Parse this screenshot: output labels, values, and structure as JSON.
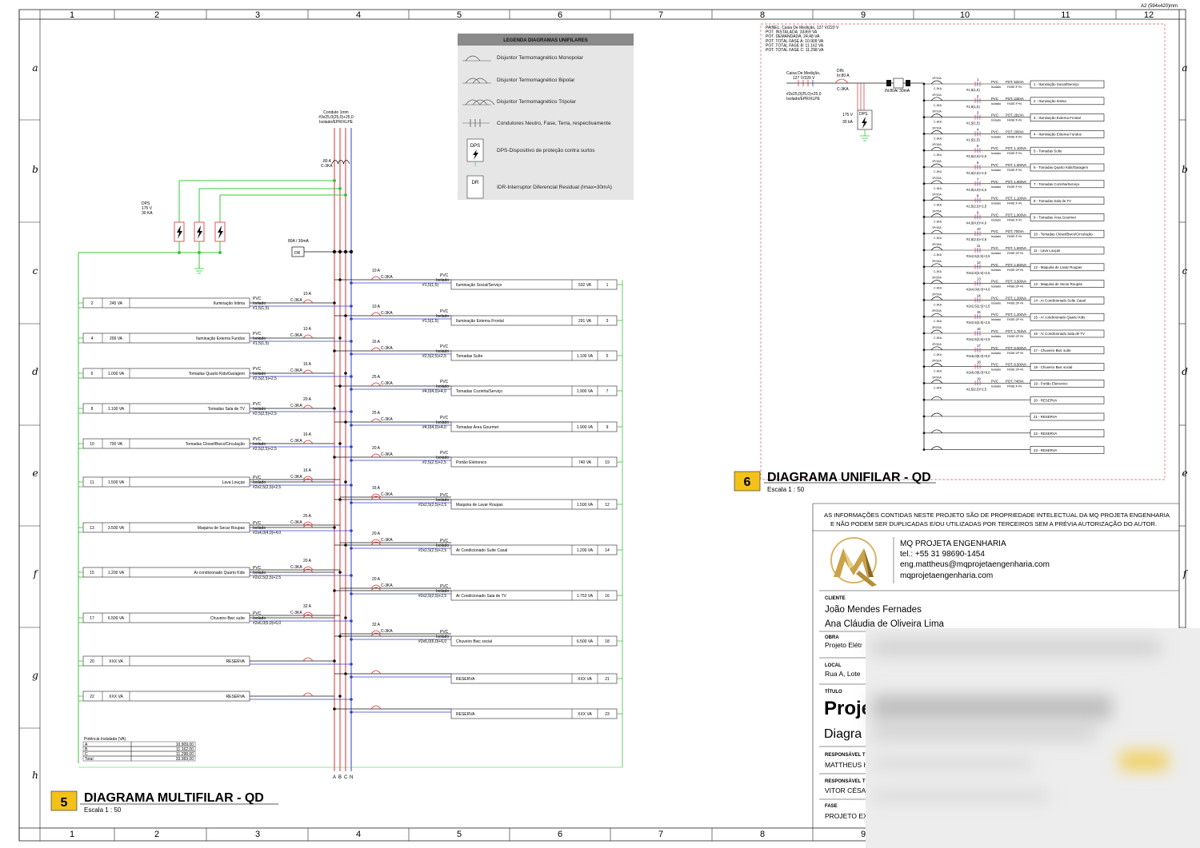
{
  "sheet": {
    "format": "A2 (594x420)mm",
    "col_labels": [
      "1",
      "2",
      "3",
      "4",
      "5",
      "6",
      "7",
      "8",
      "9",
      "10",
      "11",
      "12"
    ],
    "row_labels": [
      "a",
      "b",
      "c",
      "d",
      "e",
      "f",
      "g",
      "h"
    ]
  },
  "legend": {
    "title": "LEGENDA DIAGRAMAS UNIFILARES",
    "items": [
      {
        "icon": "monopolar-breaker-icon",
        "label": "Disjuntor Termomagnético Monopolar"
      },
      {
        "icon": "bipolar-breaker-icon",
        "label": "Disjuntor Termomagnético Bipolar"
      },
      {
        "icon": "tripolar-breaker-icon",
        "label": "Disjuntor Termomagnético Tripolar"
      },
      {
        "icon": "conductors-icon",
        "label": "Condutores Neutro, Fase, Terra, respectivamente"
      },
      {
        "icon": "dps-icon",
        "badge": "DPS",
        "label": "DPS-Dispositivo de proteção contra surtos"
      },
      {
        "icon": "idr-icon",
        "badge": "DR",
        "label": "IDR-Interruptor Diferencial Residual (Imax=30mA)"
      }
    ]
  },
  "multifilar": {
    "number": "5",
    "title": "DIAGRAMA MULTIFILAR - QD",
    "scale": "Escala   1 : 50",
    "conduit": [
      "Conduto 1mm",
      "#3x25,0(25,0)+25,0",
      "Isolado/EPR/XLPE"
    ],
    "main_breaker": [
      "80 A",
      "C-3KA"
    ],
    "dps": [
      "DPS",
      "175 V",
      "30 KA"
    ],
    "dr": {
      "rating": "80A / 30mA",
      "badge": "DR"
    },
    "phase_labels": [
      "A",
      "B",
      "C",
      "N"
    ],
    "left_circuits": [
      {
        "num": "2",
        "pot": "245 VA",
        "desc": "Iluminação Intima",
        "breaker": "10 A",
        "curve": "C-3KA",
        "cable": "#1,5(1,5)"
      },
      {
        "num": "4",
        "pot": "209 VA",
        "desc": "Iluminação Externa Fundos",
        "breaker": "10 A",
        "curve": "C-3KA",
        "cable": "#1,5(1,5)"
      },
      {
        "num": "6",
        "pot": "1.000 VA",
        "desc": "Tomadas Quarto Kids/Garagem",
        "breaker": "16 A",
        "curve": "C-3KA",
        "cable": "#2,5(2,5)+2,5"
      },
      {
        "num": "8",
        "pot": "1.100 VA",
        "desc": "Tomadas Sala de TV",
        "breaker": "20 A",
        "curve": "C-3KA",
        "cable": "#2,5(2,5)+2,5"
      },
      {
        "num": "10",
        "pot": "700 VA",
        "desc": "Tomadas Closet/Bwcs/Circulação",
        "breaker": "16 A",
        "curve": "C-3KA",
        "cable": "#2,5(2,5)+2,5"
      },
      {
        "num": "11",
        "pot": "1.500 VA",
        "desc": "Lava Louças",
        "breaker": "16 A",
        "curve": "C-3KA",
        "cable": "#2x2,5(2,5)+2,5"
      },
      {
        "num": "13",
        "pot": "3.500 VA",
        "desc": "Maquina de Secar Roupas",
        "breaker": "25 A",
        "curve": "C-3KA",
        "cable": "#2x4,0(4,0)+4,0"
      },
      {
        "num": "15",
        "pot": "1.200 VA",
        "desc": "Ar condicionado Quarto Kids",
        "breaker": "20 A",
        "curve": "C-3KA",
        "cable": "#2x2,5(2,5)+2,5"
      },
      {
        "num": "17",
        "pot": "6.500 VA",
        "desc": "Chuveiro Bwc suíte",
        "breaker": "32 A",
        "curve": "C-3KA",
        "cable": "#2x6,0(6,0)+6,0"
      },
      {
        "num": "20",
        "pot": "XXX VA",
        "desc": "RESERVA",
        "breaker": "",
        "curve": "",
        "cable": ""
      },
      {
        "num": "22",
        "pot": "XXX VA",
        "desc": "RESERVA",
        "breaker": "",
        "curve": "",
        "cable": ""
      }
    ],
    "right_circuits": [
      {
        "num": "1",
        "pot": "532 VA",
        "desc": "Iluminação Social/Serviço",
        "breaker": "10 A",
        "curve": "C-3KA",
        "cable": "#1,5(1,5)"
      },
      {
        "num": "3",
        "pot": "291 VA",
        "desc": "Iluminação Externa Frontal",
        "breaker": "10 A",
        "curve": "C-3KA",
        "cable": "#1,5(1,5)"
      },
      {
        "num": "5",
        "pot": "1.100 VA",
        "desc": "Tomadas Suíte",
        "breaker": "16 A",
        "curve": "C-3KA",
        "cable": "#2,5(2,5)+2,5"
      },
      {
        "num": "7",
        "pot": "1.900 VA",
        "desc": "Tomadas Cozinha/Serviço",
        "breaker": "25 A",
        "curve": "C-3KA",
        "cable": "#4,0(4,0)+4,0"
      },
      {
        "num": "9",
        "pot": "1.900 VA",
        "desc": "Tomadas Área Gourmet",
        "breaker": "25 A",
        "curve": "C-3KA",
        "cable": "#4,0(4,0)+4,0"
      },
      {
        "num": "19",
        "pot": "740 VA",
        "desc": "Portão Eletronico",
        "breaker": "20 A",
        "curve": "C-3KA",
        "cable": "#2,5(2,5)+2,5"
      },
      {
        "num": "12",
        "pot": "1.500 VA",
        "desc": "Maquina de Lavar Roupas",
        "breaker": "16 A",
        "curve": "C-3KA",
        "cable": "#2x2,5(2,5)+2,5"
      },
      {
        "num": "14",
        "pot": "1.200 VA",
        "desc": "Ar Condicionado Suíte Casal",
        "breaker": "20 A",
        "curve": "C-3KA",
        "cable": "#2x2,5(2,5)+2,5"
      },
      {
        "num": "16",
        "pot": "1.753 VA",
        "desc": "Ar Condicionado Sala de TV",
        "breaker": "20 A",
        "curve": "C-3KA",
        "cable": "#2x2,5(2,5)+2,5"
      },
      {
        "num": "18",
        "pot": "6.500 VA",
        "desc": "Chuveiro Bwc social",
        "breaker": "32 A",
        "curve": "C-3KA",
        "cable": "#2x6,0(6,0)+6,0"
      },
      {
        "num": "21",
        "pot": "XXX VA",
        "desc": "RESERVA",
        "breaker": "",
        "curve": "",
        "cable": ""
      },
      {
        "num": "23",
        "pot": "XXX VA",
        "desc": "RESERVA",
        "breaker": "",
        "curve": "",
        "cable": ""
      }
    ],
    "wire_texts": [
      "PVC",
      "Isolado"
    ],
    "power_table": {
      "title": "Potência Instalada (VA)",
      "rows": [
        {
          "phase": "A",
          "value": "10.909,00"
        },
        {
          "phase": "B",
          "value": "11.162,00"
        },
        {
          "phase": "C",
          "value": "11.298,00"
        },
        {
          "phase": "Total",
          "value": "33.369,00"
        }
      ]
    }
  },
  "unifilar": {
    "number": "6",
    "title": "DIAGRAMA UNIFILAR - QD",
    "scale": "Escala   1 : 50",
    "panel_info": [
      "PAINEL: Caixa De Medição, 127 V/220 V",
      "POT. INSTALADA: 33369 VA",
      "POT. DEMANDADA: 24,48 VA",
      "POT. TOTAL FASE A: 10.909 VA",
      "POT. TOTAL FASE B: 11.162 VA",
      "POT. TOTAL FASE C: 11.298 VA"
    ],
    "supply": [
      "Caixa De Medição,",
      "127 V/220 V"
    ],
    "supply_cable": [
      "#3x25,0(25,0)+25,0",
      "Isolado/EPR/XLPE"
    ],
    "din": [
      "DIN",
      "In:80 A"
    ],
    "din_curve": "C-3KA",
    "idr": "IN:80A/ 30mA",
    "dps": [
      "175 V",
      "30 kA"
    ],
    "dps_badge": "DPS",
    "circuits": [
      {
        "n": "1",
        "rating": "1P/10A",
        "cable": "#1,5(1,5)",
        "pot": "POT.:532VA",
        "fase": "FASE:F+N",
        "desc": "1 - Iluminação Social/Serviço"
      },
      {
        "n": "2",
        "rating": "1P/10A",
        "cable": "#1,5(1,5)",
        "pot": "POT.:245VA",
        "fase": "FASE:F+N",
        "desc": "2 - Iluminação Intima"
      },
      {
        "n": "3",
        "rating": "1P/10A",
        "cable": "#1,5(1,5)",
        "pot": "POT.:291VA",
        "fase": "FASE:F+N",
        "desc": "3 - Iluminação Externa Frontal"
      },
      {
        "n": "4",
        "rating": "1P/10A",
        "cable": "#1,5(1,5)",
        "pot": "POT.:209VA",
        "fase": "FASE:F+N",
        "desc": "4 - Iluminação Externa Fundos"
      },
      {
        "n": "5",
        "rating": "1P/16A",
        "cable": "#2,5(2,5)+2,5",
        "pot": "POT.:1.100VA",
        "fase": "FASE:F+N",
        "desc": "5 - Tomadas Suíte"
      },
      {
        "n": "6",
        "rating": "1P/16A",
        "cable": "#2,5(2,5)+2,5",
        "pot": "POT.:1.000VA",
        "fase": "FASE:F+N",
        "desc": "6 - Tomadas Quarto Kids/Garagem"
      },
      {
        "n": "7",
        "rating": "1P/25A",
        "cable": "#4,0(4,0)+4,0",
        "pot": "POT.:1.900VA",
        "fase": "FASE:F+N",
        "desc": "7 - Tomadas Cozinha/Serviço"
      },
      {
        "n": "8",
        "rating": "1P/20A",
        "cable": "#2,5(2,5)+2,5",
        "pot": "POT.:1.100VA",
        "fase": "FASE:F+N",
        "desc": "8 - Tomadas Sala de TV"
      },
      {
        "n": "9",
        "rating": "1P/25A",
        "cable": "#4,0(4,0)+4,0",
        "pot": "POT.:1.900VA",
        "fase": "FASE:F+N",
        "desc": "9 - Tomadas Área Gourmet"
      },
      {
        "n": "10",
        "rating": "1P/16A",
        "cable": "#2,5(2,5)+2,5",
        "pot": "POT.:700VA",
        "fase": "FASE:F+N",
        "desc": "10 - Tomadas Closet/Bwcs/Circulação"
      },
      {
        "n": "11",
        "rating": "2P/16A",
        "cable": "#2x2,5(2,5)+2,5",
        "pot": "POT.:1.500VA",
        "fase": "FASE:2F+N",
        "desc": "11 - Lava Louças"
      },
      {
        "n": "12",
        "rating": "2P/16A",
        "cable": "#2x2,5(2,5)+2,5",
        "pot": "POT.:1.500VA",
        "fase": "FASE:2F+N",
        "desc": "12 - Maquina de Lavar Roupas"
      },
      {
        "n": "13",
        "rating": "2P/25A",
        "cable": "#2x4,0(4,0)+4,0",
        "pot": "POT.:3.500VA",
        "fase": "FASE:2F+N",
        "desc": "13 - Maquina de Secar Roupas"
      },
      {
        "n": "14",
        "rating": "2P/20A",
        "cable": "#2x2,5(2,5)+2,5",
        "pot": "POT.:1.200VA",
        "fase": "FASE:2F+N",
        "desc": "14 - Ar Condicionado Suíte Casal"
      },
      {
        "n": "15",
        "rating": "2P/20A",
        "cable": "#2x2,5(2,5)+2,5",
        "pot": "POT.:1.200VA",
        "fase": "FASE:2F+N",
        "desc": "15 - Ar condicionado Quarto Kids"
      },
      {
        "n": "16",
        "rating": "2P/20A",
        "cable": "#2x2,5(2,5)+2,5",
        "pot": "POT.:1.753VA",
        "fase": "FASE:2F+N",
        "desc": "16 - Ar Condicionado Sala de TV"
      },
      {
        "n": "17",
        "rating": "2P/32A",
        "cable": "#2x6,0(6,0)+6,0",
        "pot": "POT.:6.500VA",
        "fase": "FASE:2F+N",
        "desc": "17 - Chuveiro Bwc suíte"
      },
      {
        "n": "18",
        "rating": "2P/32A",
        "cable": "#2x6,0(6,0)+6,0",
        "pot": "POT.:6.500VA",
        "fase": "FASE:2F+N",
        "desc": "18 - Chuveiro Bwc social"
      },
      {
        "n": "19",
        "rating": "1P/20A",
        "cable": "#2,5(2,5)+2,5",
        "pot": "POT.:740VA",
        "fase": "FASE:F+N",
        "desc": "19 - Portão Eletronico"
      },
      {
        "n": "",
        "rating": "",
        "cable": "",
        "pot": "",
        "fase": "",
        "desc": "20 - RESERVA"
      },
      {
        "n": "",
        "rating": "",
        "cable": "",
        "pot": "",
        "fase": "",
        "desc": "21 - RESERVA"
      },
      {
        "n": "",
        "rating": "",
        "cable": "",
        "pot": "",
        "fase": "",
        "desc": "22 - RESERVA"
      },
      {
        "n": "",
        "rating": "",
        "cable": "",
        "pot": "",
        "fase": "",
        "desc": "23 - RESERVA"
      }
    ],
    "wire_texts": [
      "PVC",
      "Isolado"
    ]
  },
  "title_block": {
    "disclaimer": [
      "AS INFORMAÇÕES CONTIDAS NESTE PROJETO SÃO DE PROPRIEDADE INTELECTUAL DA MQ PROJETA ENGENHARIA",
      "E NÃO PODEM SER DUPLICADAS E/OU UTILIZADAS POR TERCEIROS SEM A PRÉVIA AUTORIZAÇÃO DO AUTOR."
    ],
    "company": {
      "name": "MQ PROJETA ENGENHARIA",
      "phone": "tel.: +55 31 98690-1454",
      "email": "eng.mattheus@mqprojetaengenharia.com",
      "site": "mqprojetaengenharia.com",
      "logo_colors": [
        "#c9a24a",
        "#e8cf8a",
        "#8a6a2a"
      ]
    },
    "cliente_label": "CLIENTE",
    "cliente": [
      "João Mendes Fernades",
      "Ana Cláudia de Oliveira Lima"
    ],
    "obra_label": "OBRA",
    "obra": "Projeto Elétr",
    "local_label": "LOCAL",
    "local": "Rua A, Lote",
    "titulo_label": "TÍTULO",
    "titulo": "Proje",
    "titulo_sub": "Diagra",
    "resp1_label": "RESPONSÁVEL TÉ",
    "resp1": "MATTHEUS H",
    "resp2_label": "RESPONSÁVEL TÉ",
    "resp2": "VITOR CÉSAR",
    "fase_label": "FASE",
    "fase": "PROJETO EX"
  },
  "colors": {
    "phase_red": "#d43030",
    "neutral_blue": "#3040c8",
    "ground_green": "#3cc43c",
    "badge_yellow": "#f2c21b",
    "unifilar_border": "#e05a5a"
  }
}
